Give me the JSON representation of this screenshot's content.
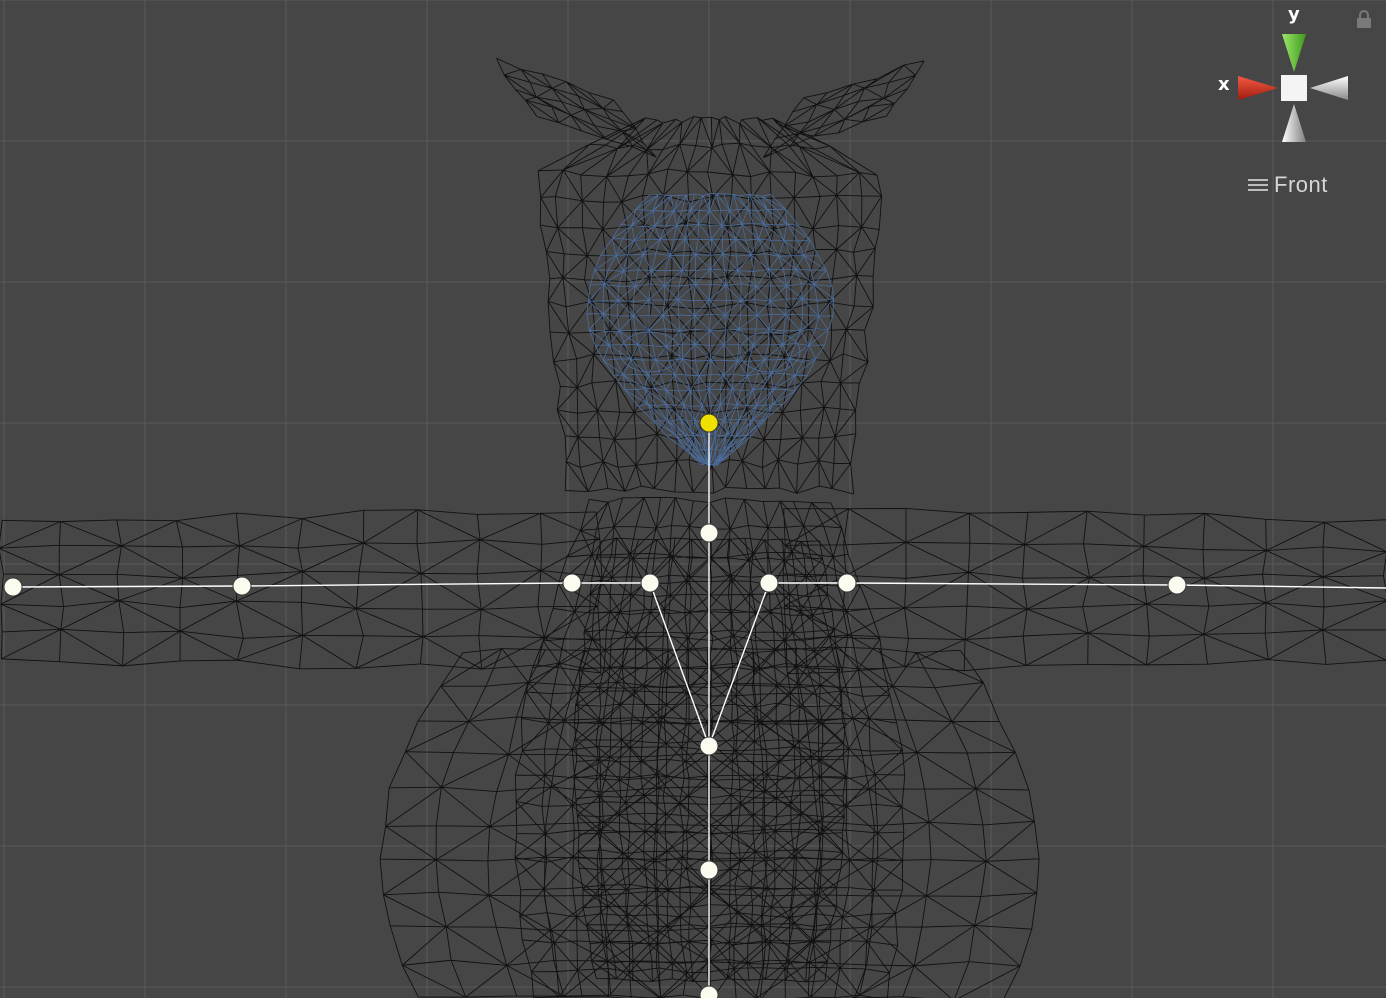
{
  "viewport": {
    "projection_label": "Front",
    "background_color": "#464646",
    "grid_color": "#5a5a5a",
    "wireframe_color": "#111111",
    "face_wireframe_color": "#4a6c9c",
    "bone_color": "#ffffff",
    "selected_bone_color": "#f0e000"
  },
  "gizmo": {
    "x_label": "x",
    "y_label": "y",
    "x_color": "#d9331f",
    "y_color": "#6fd13a",
    "neutral_color": "#e0e0e0",
    "center_color": "#f2f2f2"
  },
  "icons": {
    "lock": "lock-icon",
    "view_menu": "hamburger-menu-icon"
  }
}
